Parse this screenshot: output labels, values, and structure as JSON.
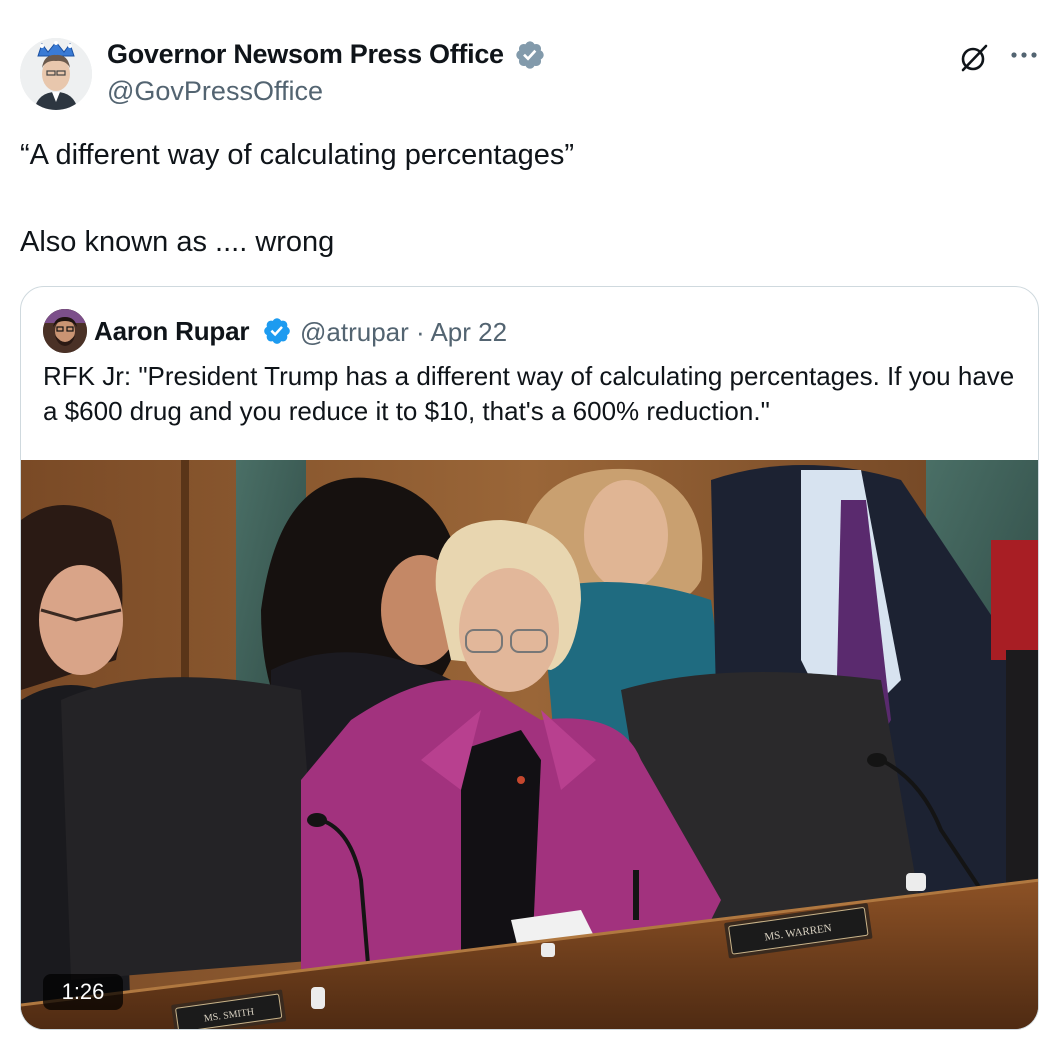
{
  "post": {
    "author": {
      "name": "Governor Newsom Press Office",
      "handle": "@GovPressOffice",
      "verified_badge": "verified-badge-icon",
      "badge_color": "#829aab"
    },
    "actions": [
      "grok-icon",
      "more-options-icon"
    ],
    "text_lines": [
      "“A different way of calculating percentages”",
      "Also known as .... wrong"
    ]
  },
  "quoted_post": {
    "author": {
      "name": "Aaron Rupar",
      "handle_and_date": "@atrupar · Apr 22",
      "verified_badge": "verified-badge-icon",
      "badge_color": "#1d9bf0"
    },
    "text": "RFK Jr: \"President Trump has a different way of calculating percentages. If you have a $600 drug and you reduce it to $10, that's a 600% reduction.\"",
    "video": {
      "duration": "1:26",
      "nameplates": [
        "MS. WARREN",
        "MS. SMITH"
      ]
    }
  }
}
